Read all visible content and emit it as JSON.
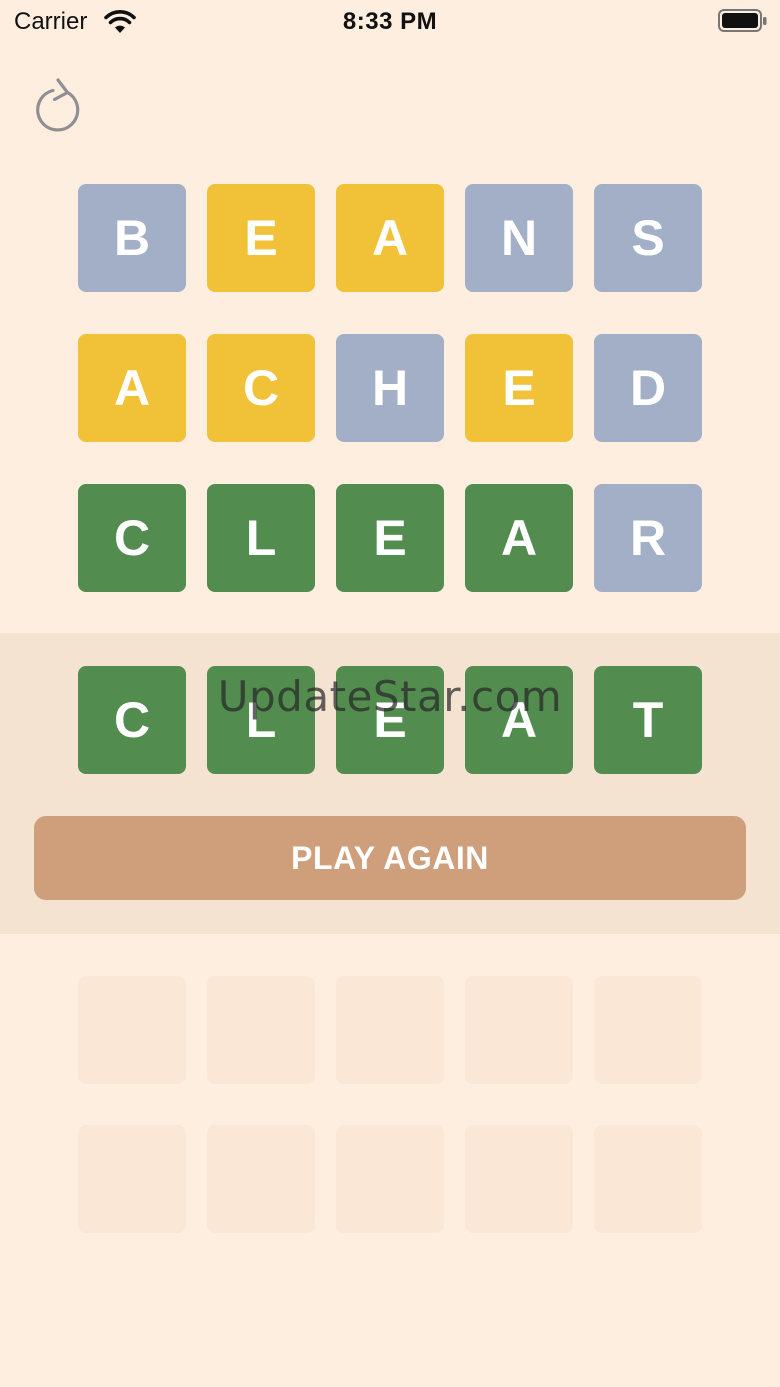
{
  "status_bar": {
    "carrier": "Carrier",
    "time": "8:33 PM",
    "wifi_icon": "wifi-icon",
    "battery_icon": "battery-icon"
  },
  "toolbar": {
    "refresh_icon": "refresh-icon"
  },
  "colors": {
    "background": "#feeedf",
    "absent": "#a2afc7",
    "present": "#f1c237",
    "correct": "#528c4f",
    "empty": "#fbe7d5",
    "result_band": "#f4e3d0",
    "button": "#cf9f7c"
  },
  "board": {
    "guesses": [
      [
        {
          "letter": "B",
          "state": "absent"
        },
        {
          "letter": "E",
          "state": "present"
        },
        {
          "letter": "A",
          "state": "present"
        },
        {
          "letter": "N",
          "state": "absent"
        },
        {
          "letter": "S",
          "state": "absent"
        }
      ],
      [
        {
          "letter": "A",
          "state": "present"
        },
        {
          "letter": "C",
          "state": "present"
        },
        {
          "letter": "H",
          "state": "absent"
        },
        {
          "letter": "E",
          "state": "present"
        },
        {
          "letter": "D",
          "state": "absent"
        }
      ],
      [
        {
          "letter": "C",
          "state": "correct"
        },
        {
          "letter": "L",
          "state": "correct"
        },
        {
          "letter": "E",
          "state": "correct"
        },
        {
          "letter": "A",
          "state": "correct"
        },
        {
          "letter": "R",
          "state": "absent"
        }
      ]
    ],
    "empty_rows": 2,
    "columns": 5
  },
  "result": {
    "answer": [
      {
        "letter": "C",
        "state": "correct"
      },
      {
        "letter": "L",
        "state": "correct"
      },
      {
        "letter": "E",
        "state": "correct"
      },
      {
        "letter": "A",
        "state": "correct"
      },
      {
        "letter": "T",
        "state": "correct"
      }
    ],
    "play_again_label": "PLAY AGAIN"
  },
  "watermark": "UpdateStar.com"
}
